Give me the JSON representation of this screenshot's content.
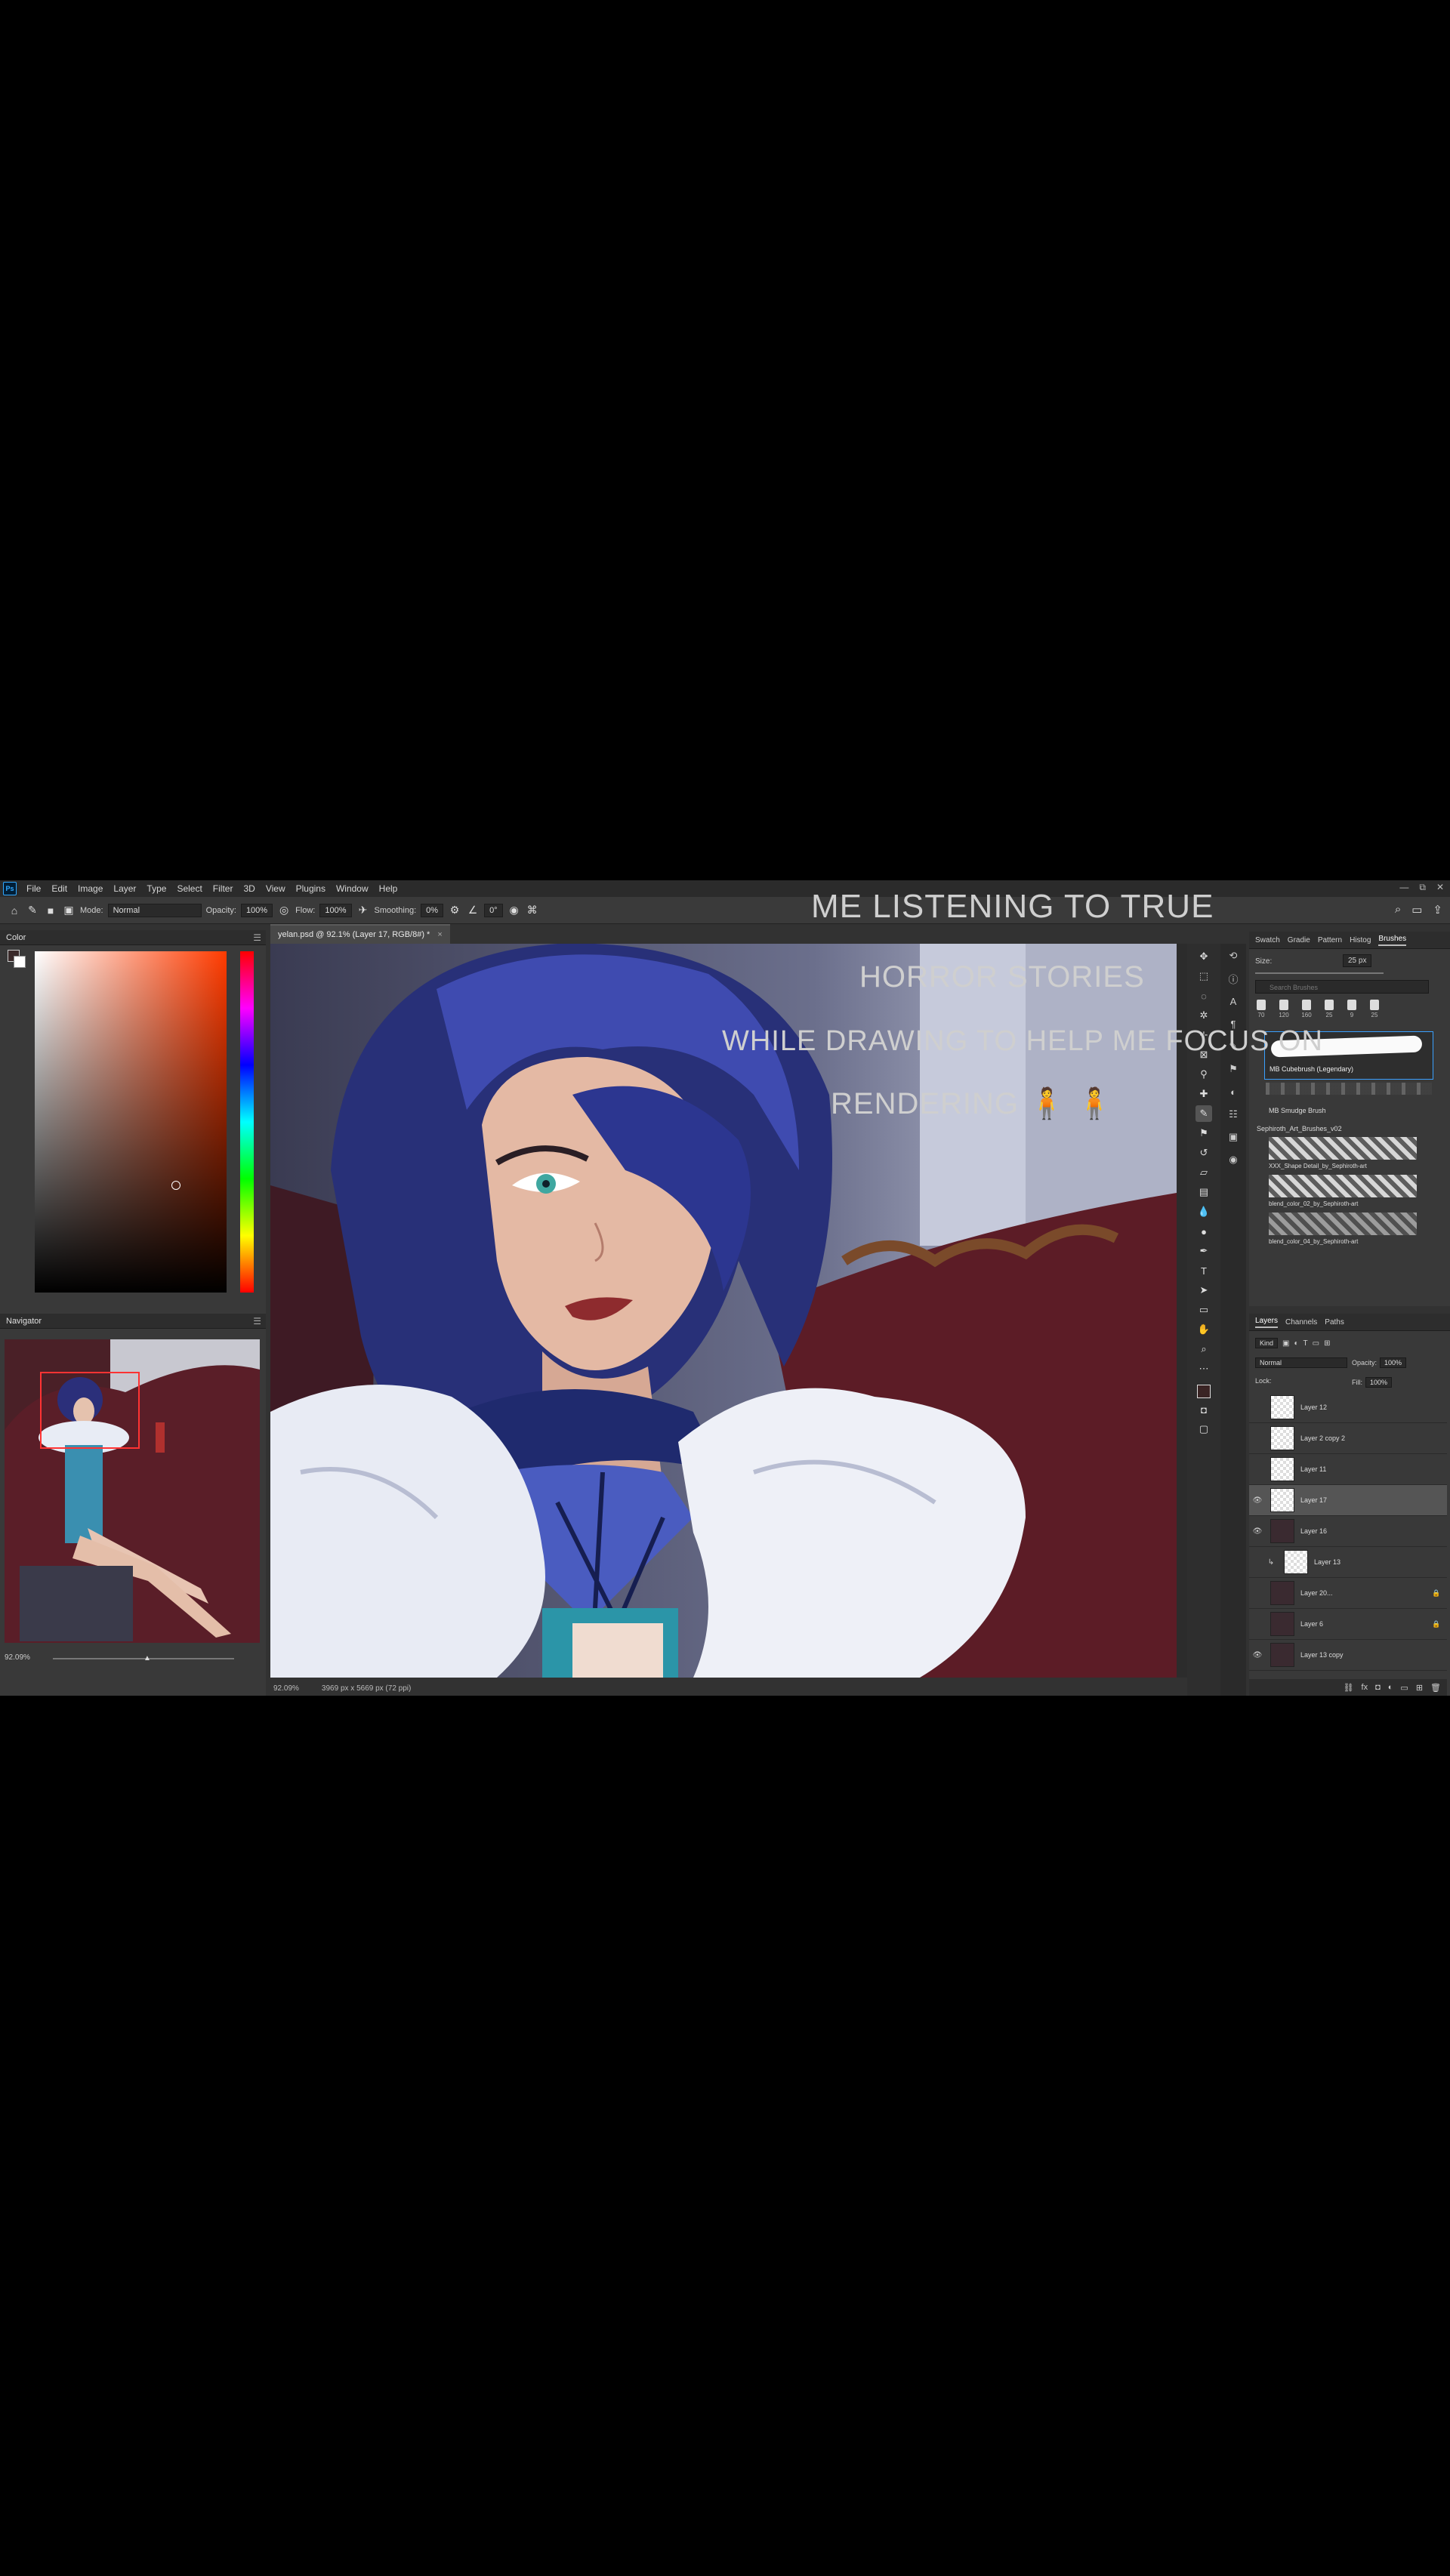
{
  "app": {
    "logo": "Ps",
    "menu": [
      "File",
      "Edit",
      "Image",
      "Layer",
      "Type",
      "Select",
      "Filter",
      "3D",
      "View",
      "Plugins",
      "Window",
      "Help"
    ],
    "window_controls": [
      "—",
      "⧉",
      "✕"
    ]
  },
  "options_bar": {
    "mode_label": "Mode:",
    "mode_value": "Normal",
    "opacity_label": "Opacity:",
    "opacity_value": "100%",
    "flow_label": "Flow:",
    "flow_value": "100%",
    "smoothing_label": "Smoothing:",
    "smoothing_value": "0%",
    "angle_value": "0°"
  },
  "panels": {
    "color_title": "Color",
    "navigator_title": "Navigator",
    "navigator_zoom": "92.09%"
  },
  "document": {
    "tab_title": "yelan.psd @ 92.1% (Layer 17, RGB/8#) *",
    "status_zoom": "92.09%",
    "status_size": "3969 px x 5669 px (72 ppi)"
  },
  "brushes": {
    "tabs": [
      "Swatch",
      "Gradie",
      "Pattern",
      "Histog",
      "Brushes"
    ],
    "active_tab": "Brushes",
    "size_label": "Size:",
    "size_value": "25 px",
    "search_placeholder": "Search Brushes",
    "presets": [
      "70",
      "120",
      "160",
      "25",
      "9",
      "25"
    ],
    "selected_brush": "MB Cubebrush (Legendary)",
    "brush2": "MB Smudge Brush",
    "group": "Sephiroth_Art_Brushes_v02",
    "items": [
      "XXX_Shape Detail_by_Sephiroth-art",
      "blend_color_02_by_Sephiroth-art",
      "blend_color_04_by_Sephiroth-art"
    ]
  },
  "layers": {
    "tabs": [
      "Layers",
      "Channels",
      "Paths"
    ],
    "active_tab": "Layers",
    "kind_label": "Kind",
    "blend_mode": "Normal",
    "opacity_label": "Opacity:",
    "opacity_value": "100%",
    "lock_label": "Lock:",
    "fill_label": "Fill:",
    "fill_value": "100%",
    "list": [
      {
        "name": "Layer 12"
      },
      {
        "name": "Layer 2 copy 2"
      },
      {
        "name": "Layer 11"
      },
      {
        "name": "Layer 17"
      },
      {
        "name": "Layer 16"
      },
      {
        "name": "Layer 13"
      },
      {
        "name": "Layer 20..."
      },
      {
        "name": "Layer 6"
      },
      {
        "name": "Layer 13 copy"
      }
    ]
  },
  "caption": {
    "line1": "ME LISTENING TO TRUE",
    "line2": "HORROR STORIES",
    "line3": "WHILE DRAWING TO HELP ME FOCUS ON",
    "line4": "RENDERING 🧍 🧍"
  },
  "colors": {
    "accent": "#31a8ff",
    "selection": "#3aa0ff"
  }
}
